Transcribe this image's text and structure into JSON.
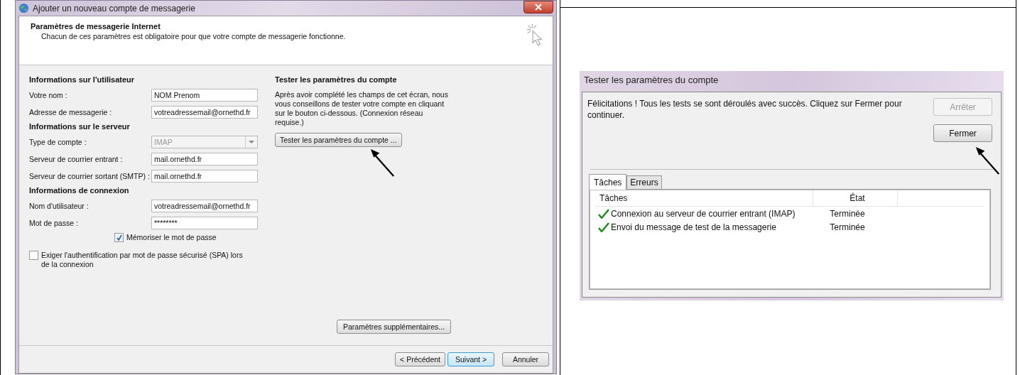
{
  "left_window": {
    "title": "Ajouter un nouveau compte de messagerie",
    "header": {
      "title": "Paramètres de messagerie Internet",
      "subtitle": "Chacun de ces paramètres est obligatoire pour que votre compte de messagerie fonctionne."
    },
    "sections": [
      {
        "heading": "Informations sur l'utilisateur",
        "fields": [
          {
            "kind": "text",
            "label": "Votre nom :",
            "value": "NOM Prenom"
          },
          {
            "kind": "text",
            "label": "Adresse de messagerie :",
            "value": "votreadressemail@ornethd.fr"
          }
        ]
      },
      {
        "heading": "Informations sur le serveur",
        "fields": [
          {
            "kind": "select",
            "label": "Type de compte :",
            "value": "IMAP",
            "disabled": true
          },
          {
            "kind": "text",
            "label": "Serveur de courrier entrant :",
            "value": "mail.ornethd.fr"
          },
          {
            "kind": "text",
            "label": "Serveur de courrier sortant (SMTP) :",
            "value": "mail.ornethd.fr"
          }
        ]
      },
      {
        "heading": "Informations de connexion",
        "fields": [
          {
            "kind": "text",
            "label": "Nom d'utilisateur :",
            "value": "votreadressemail@ornethd.fr"
          },
          {
            "kind": "password",
            "label": "Mot de passe :",
            "value": "********"
          }
        ]
      }
    ],
    "remember": {
      "label": "Mémoriser le mot de passe",
      "checked": true
    },
    "spa": {
      "label": "Exiger l'authentification par mot de passe sécurisé (SPA) lors de la connexion",
      "checked": false
    },
    "test": {
      "heading": "Tester les paramètres du compte",
      "text": "Après avoir complété les champs de cet écran, nous vous conseillons de tester votre compte en cliquant sur le bouton ci-dessous. (Connexion réseau requise.)",
      "button": "Tester les paramètres du compte ..."
    },
    "more_button": "Paramètres supplémentaires...",
    "buttons": [
      {
        "label": "< Précédent",
        "default": false
      },
      {
        "label": "Suivant >",
        "default": true
      },
      {
        "label": "Annuler",
        "default": false
      }
    ]
  },
  "right_window": {
    "title": "Tester les paramètres du compte",
    "message": "Félicitations ! Tous les tests se sont déroulés avec succès. Cliquez sur Fermer pour continuer.",
    "buttons": [
      {
        "label": "Arrêter",
        "disabled": true
      },
      {
        "label": "Fermer",
        "disabled": false
      }
    ],
    "tabs": [
      {
        "label": "Tâches",
        "selected": true
      },
      {
        "label": "Erreurs",
        "selected": false
      }
    ],
    "table": {
      "columns": [
        "Tâches",
        "État"
      ],
      "rows": [
        {
          "task": "Connexion au serveur de courrier entrant (IMAP)",
          "state": "Terminée",
          "done": true
        },
        {
          "task": "Envoi du message de test de la messagerie",
          "state": "Terminée",
          "done": true
        }
      ]
    }
  }
}
